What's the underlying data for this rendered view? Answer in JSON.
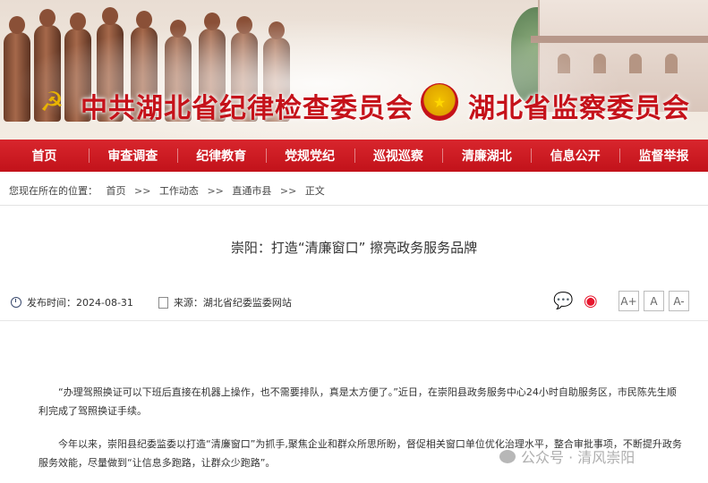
{
  "header": {
    "left_title": "中共湖北省纪律检查委员会",
    "right_title": "湖北省监察委员会",
    "brand_color": "#c5121a"
  },
  "nav": {
    "items": [
      {
        "label": "首页"
      },
      {
        "label": "审查调查"
      },
      {
        "label": "纪律教育"
      },
      {
        "label": "党规党纪"
      },
      {
        "label": "巡视巡察"
      },
      {
        "label": "清廉湖北"
      },
      {
        "label": "信息公开"
      },
      {
        "label": "监督举报"
      }
    ],
    "bg_color": "#c8161d"
  },
  "breadcrumb": {
    "prefix": "您现在所在的位置：",
    "items": [
      "首页",
      "工作动态",
      "直通市县",
      "正文"
    ],
    "separator": ">>"
  },
  "article": {
    "title": "崇阳：打造“清廉窗口” 擦亮政务服务品牌",
    "publish_time": "发布时间：2024-08-31",
    "source": "来源：湖北省纪委监委网站",
    "paragraphs": [
      "“办理驾照换证可以下班后直接在机器上操作，也不需要排队，真是太方便了。”近日，在崇阳县政务服务中心24小时自助服务区，市民陈先生顺利完成了驾照换证手续。",
      "今年以来，崇阳县纪委监委以打造“清廉窗口”为抓手,聚焦企业和群众所思所盼，督促相关窗口单位优化治理水平，整合审批事项，不断提升政务服务效能，尽量做到“让信息多跑路，让群众少跑路”。"
    ]
  },
  "font_buttons": [
    "A+",
    "A",
    "A-"
  ],
  "share": {
    "wechat_icon": "wechat-icon",
    "weibo_icon": "weibo-icon"
  },
  "watermark": "公众号 · 清风崇阳"
}
